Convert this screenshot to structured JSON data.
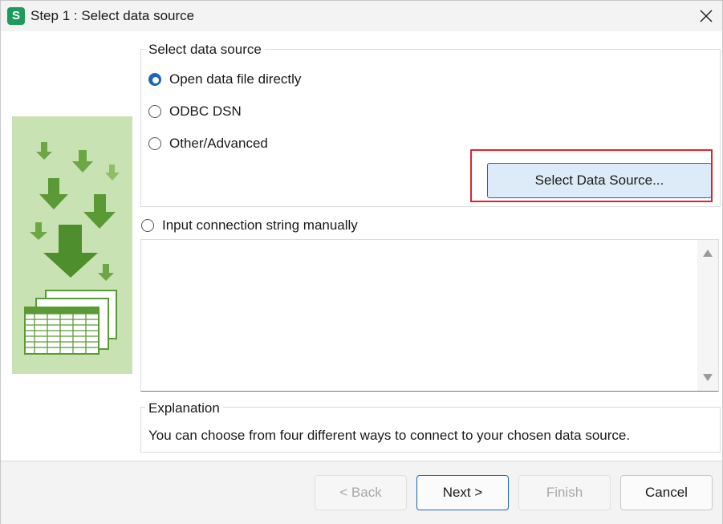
{
  "window": {
    "app_icon_letter": "S",
    "title": "Step 1 : Select data source"
  },
  "select_group": {
    "label": "Select data source",
    "options": [
      {
        "label": "Open data file directly",
        "checked": true
      },
      {
        "label": "ODBC DSN",
        "checked": false
      },
      {
        "label": "Other/Advanced",
        "checked": false
      }
    ],
    "select_button_label": "Select Data Source..."
  },
  "connection_string": {
    "label": "Input connection string manually",
    "checked": false,
    "value": ""
  },
  "explanation": {
    "label": "Explanation",
    "text": "You can choose from four different ways to connect to your chosen data source."
  },
  "footer": {
    "back_label": "< Back",
    "next_label": "Next >",
    "finish_label": "Finish",
    "cancel_label": "Cancel"
  },
  "colors": {
    "accent": "#1b66b7",
    "highlight": "#e0242b",
    "image_bg": "#c9e2b4",
    "arrow_green": "#5a9a35"
  },
  "icons": [
    "app-icon",
    "close-icon",
    "data-import-illustration",
    "scroll-up-icon",
    "scroll-down-icon"
  ]
}
